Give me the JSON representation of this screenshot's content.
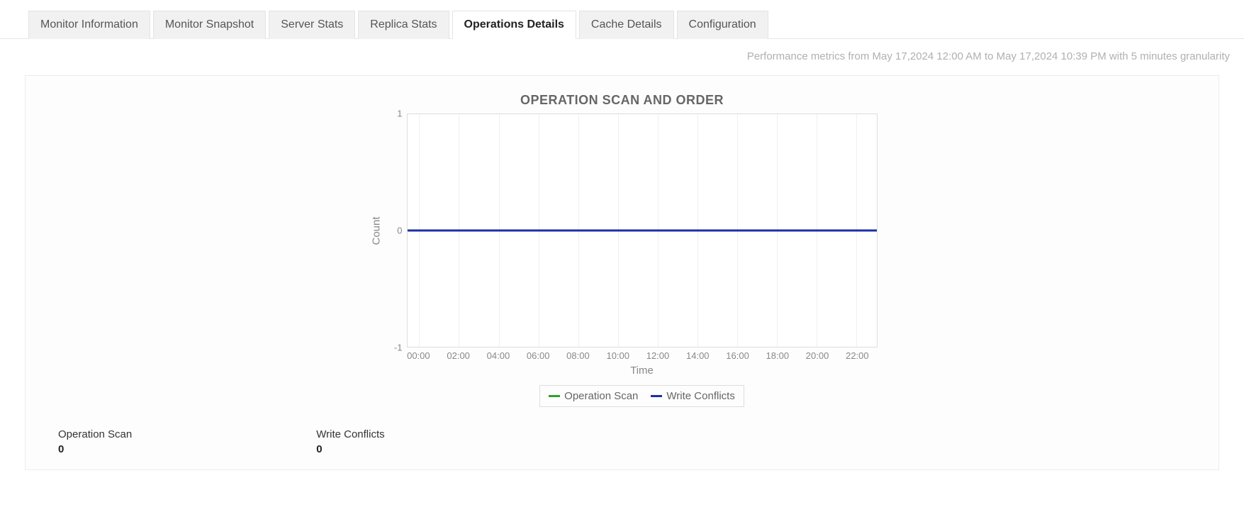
{
  "tabs": [
    {
      "label": "Monitor Information",
      "active": false
    },
    {
      "label": "Monitor Snapshot",
      "active": false
    },
    {
      "label": "Server Stats",
      "active": false
    },
    {
      "label": "Replica Stats",
      "active": false
    },
    {
      "label": "Operations Details",
      "active": true
    },
    {
      "label": "Cache Details",
      "active": false
    },
    {
      "label": "Configuration",
      "active": false
    }
  ],
  "metrics_note": "Performance metrics from May 17,2024 12:00 AM to May 17,2024 10:39 PM with 5 minutes granularity",
  "chart_title": "OPERATION SCAN AND ORDER",
  "y_label": "Count",
  "x_label": "Time",
  "legend": [
    {
      "name": "Operation Scan",
      "color": "#2fa02f"
    },
    {
      "name": "Write Conflicts",
      "color": "#1a2fa8"
    }
  ],
  "stats": [
    {
      "label": "Operation Scan",
      "value": "0"
    },
    {
      "label": "Write Conflicts",
      "value": "0"
    }
  ],
  "colors": {
    "operation_scan": "#2fa02f",
    "write_conflicts": "#1a2fa8"
  },
  "chart_data": {
    "type": "line",
    "title": "OPERATION SCAN AND ORDER",
    "xlabel": "Time",
    "ylabel": "Count",
    "ylim": [
      -1,
      1
    ],
    "y_ticks": [
      -1,
      0,
      1
    ],
    "x_ticks": [
      "00:00",
      "02:00",
      "04:00",
      "06:00",
      "08:00",
      "10:00",
      "12:00",
      "14:00",
      "16:00",
      "18:00",
      "20:00",
      "22:00"
    ],
    "categories": [
      "00:00",
      "02:00",
      "04:00",
      "06:00",
      "08:00",
      "10:00",
      "12:00",
      "14:00",
      "16:00",
      "18:00",
      "20:00",
      "22:00"
    ],
    "series": [
      {
        "name": "Operation Scan",
        "color": "#2fa02f",
        "values": [
          0,
          0,
          0,
          0,
          0,
          0,
          0,
          0,
          0,
          0,
          0,
          0
        ]
      },
      {
        "name": "Write Conflicts",
        "color": "#1a2fa8",
        "values": [
          0,
          0,
          0,
          0,
          0,
          0,
          0,
          0,
          0,
          0,
          0,
          0
        ]
      }
    ]
  }
}
